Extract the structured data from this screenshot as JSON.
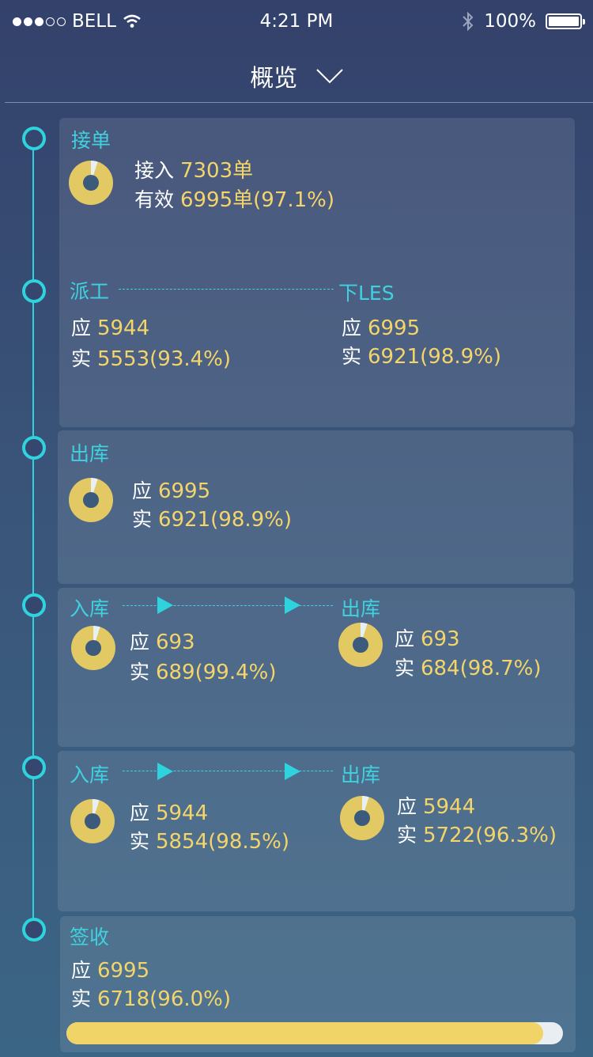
{
  "status": {
    "carrier": "BELL",
    "time": "4:21 PM",
    "battery": "100%"
  },
  "nav": {
    "title": "概览"
  },
  "s1": {
    "title": "接单",
    "l1": "接入",
    "v1": "7303单",
    "l2": "有效",
    "v2": "6995单(97.1%)"
  },
  "s2": {
    "left_title": "派工",
    "right_title": "下LES",
    "left_should_l": "应",
    "left_should": "5944",
    "left_actual_l": "实",
    "left_actual": "5553(93.4%)",
    "right_should_l": "应",
    "right_should": "6995",
    "right_actual_l": "实",
    "right_actual": "6921(98.9%)"
  },
  "s3": {
    "title": "出库",
    "should_l": "应",
    "should": "6995",
    "actual_l": "实",
    "actual": "6921(98.9%)"
  },
  "s4": {
    "left_title": "入库",
    "right_title": "出库",
    "left_should_l": "应",
    "left_should": "693",
    "left_actual_l": "实",
    "left_actual": "689(99.4%)",
    "right_should_l": "应",
    "right_should": "693",
    "right_actual_l": "实",
    "right_actual": "684(98.7%)"
  },
  "s5": {
    "left_title": "入库",
    "right_title": "出库",
    "left_should_l": "应",
    "left_should": "5944",
    "left_actual_l": "实",
    "left_actual": "5854(98.5%)",
    "right_should_l": "应",
    "right_should": "5944",
    "right_actual_l": "实",
    "right_actual": "5722(96.3%)"
  },
  "s6": {
    "title": "签收",
    "should_l": "应",
    "should": "6995",
    "actual_l": "实",
    "actual": "6718(96.0%)",
    "progress": 0.96
  },
  "colors": {
    "accent": "#2fd3de",
    "value": "#f4d56a",
    "donut": "#e3c964"
  }
}
